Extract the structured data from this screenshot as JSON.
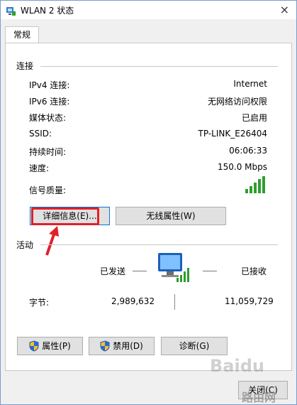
{
  "window": {
    "title": "WLAN 2 状态"
  },
  "tabs": [
    {
      "label": "常规"
    }
  ],
  "connection": {
    "section_title": "连接",
    "rows": [
      {
        "label": "IPv4 连接:",
        "value": "Internet"
      },
      {
        "label": "IPv6 连接:",
        "value": "无网络访问权限"
      },
      {
        "label": "媒体状态:",
        "value": "已启用"
      },
      {
        "label": "SSID:",
        "value": "TP-LINK_E26404"
      },
      {
        "label": "持续时间:",
        "value": "06:06:33"
      },
      {
        "label": "速度:",
        "value": "150.0 Mbps"
      }
    ],
    "signal_label": "信号质量:",
    "signal_bars": 5
  },
  "buttons_top": {
    "details": "详细信息(E)...",
    "wireless": "无线属性(W)"
  },
  "activity": {
    "section_title": "活动",
    "sent_label": "已发送",
    "received_label": "已接收",
    "bytes_label": "字节:",
    "bytes_sent": "2,989,632",
    "bytes_received": "11,059,729"
  },
  "buttons_bottom": {
    "properties": "属性(P)",
    "disable": "禁用(D)",
    "diagnose": "诊断(G)"
  },
  "footer": {
    "close": "关闭(C)"
  },
  "watermark": {
    "brand": "Baidu",
    "site": "路由网"
  },
  "colors": {
    "highlight": "#e0202a",
    "signal": "#2e9e2e",
    "focus": "#0078d7"
  }
}
